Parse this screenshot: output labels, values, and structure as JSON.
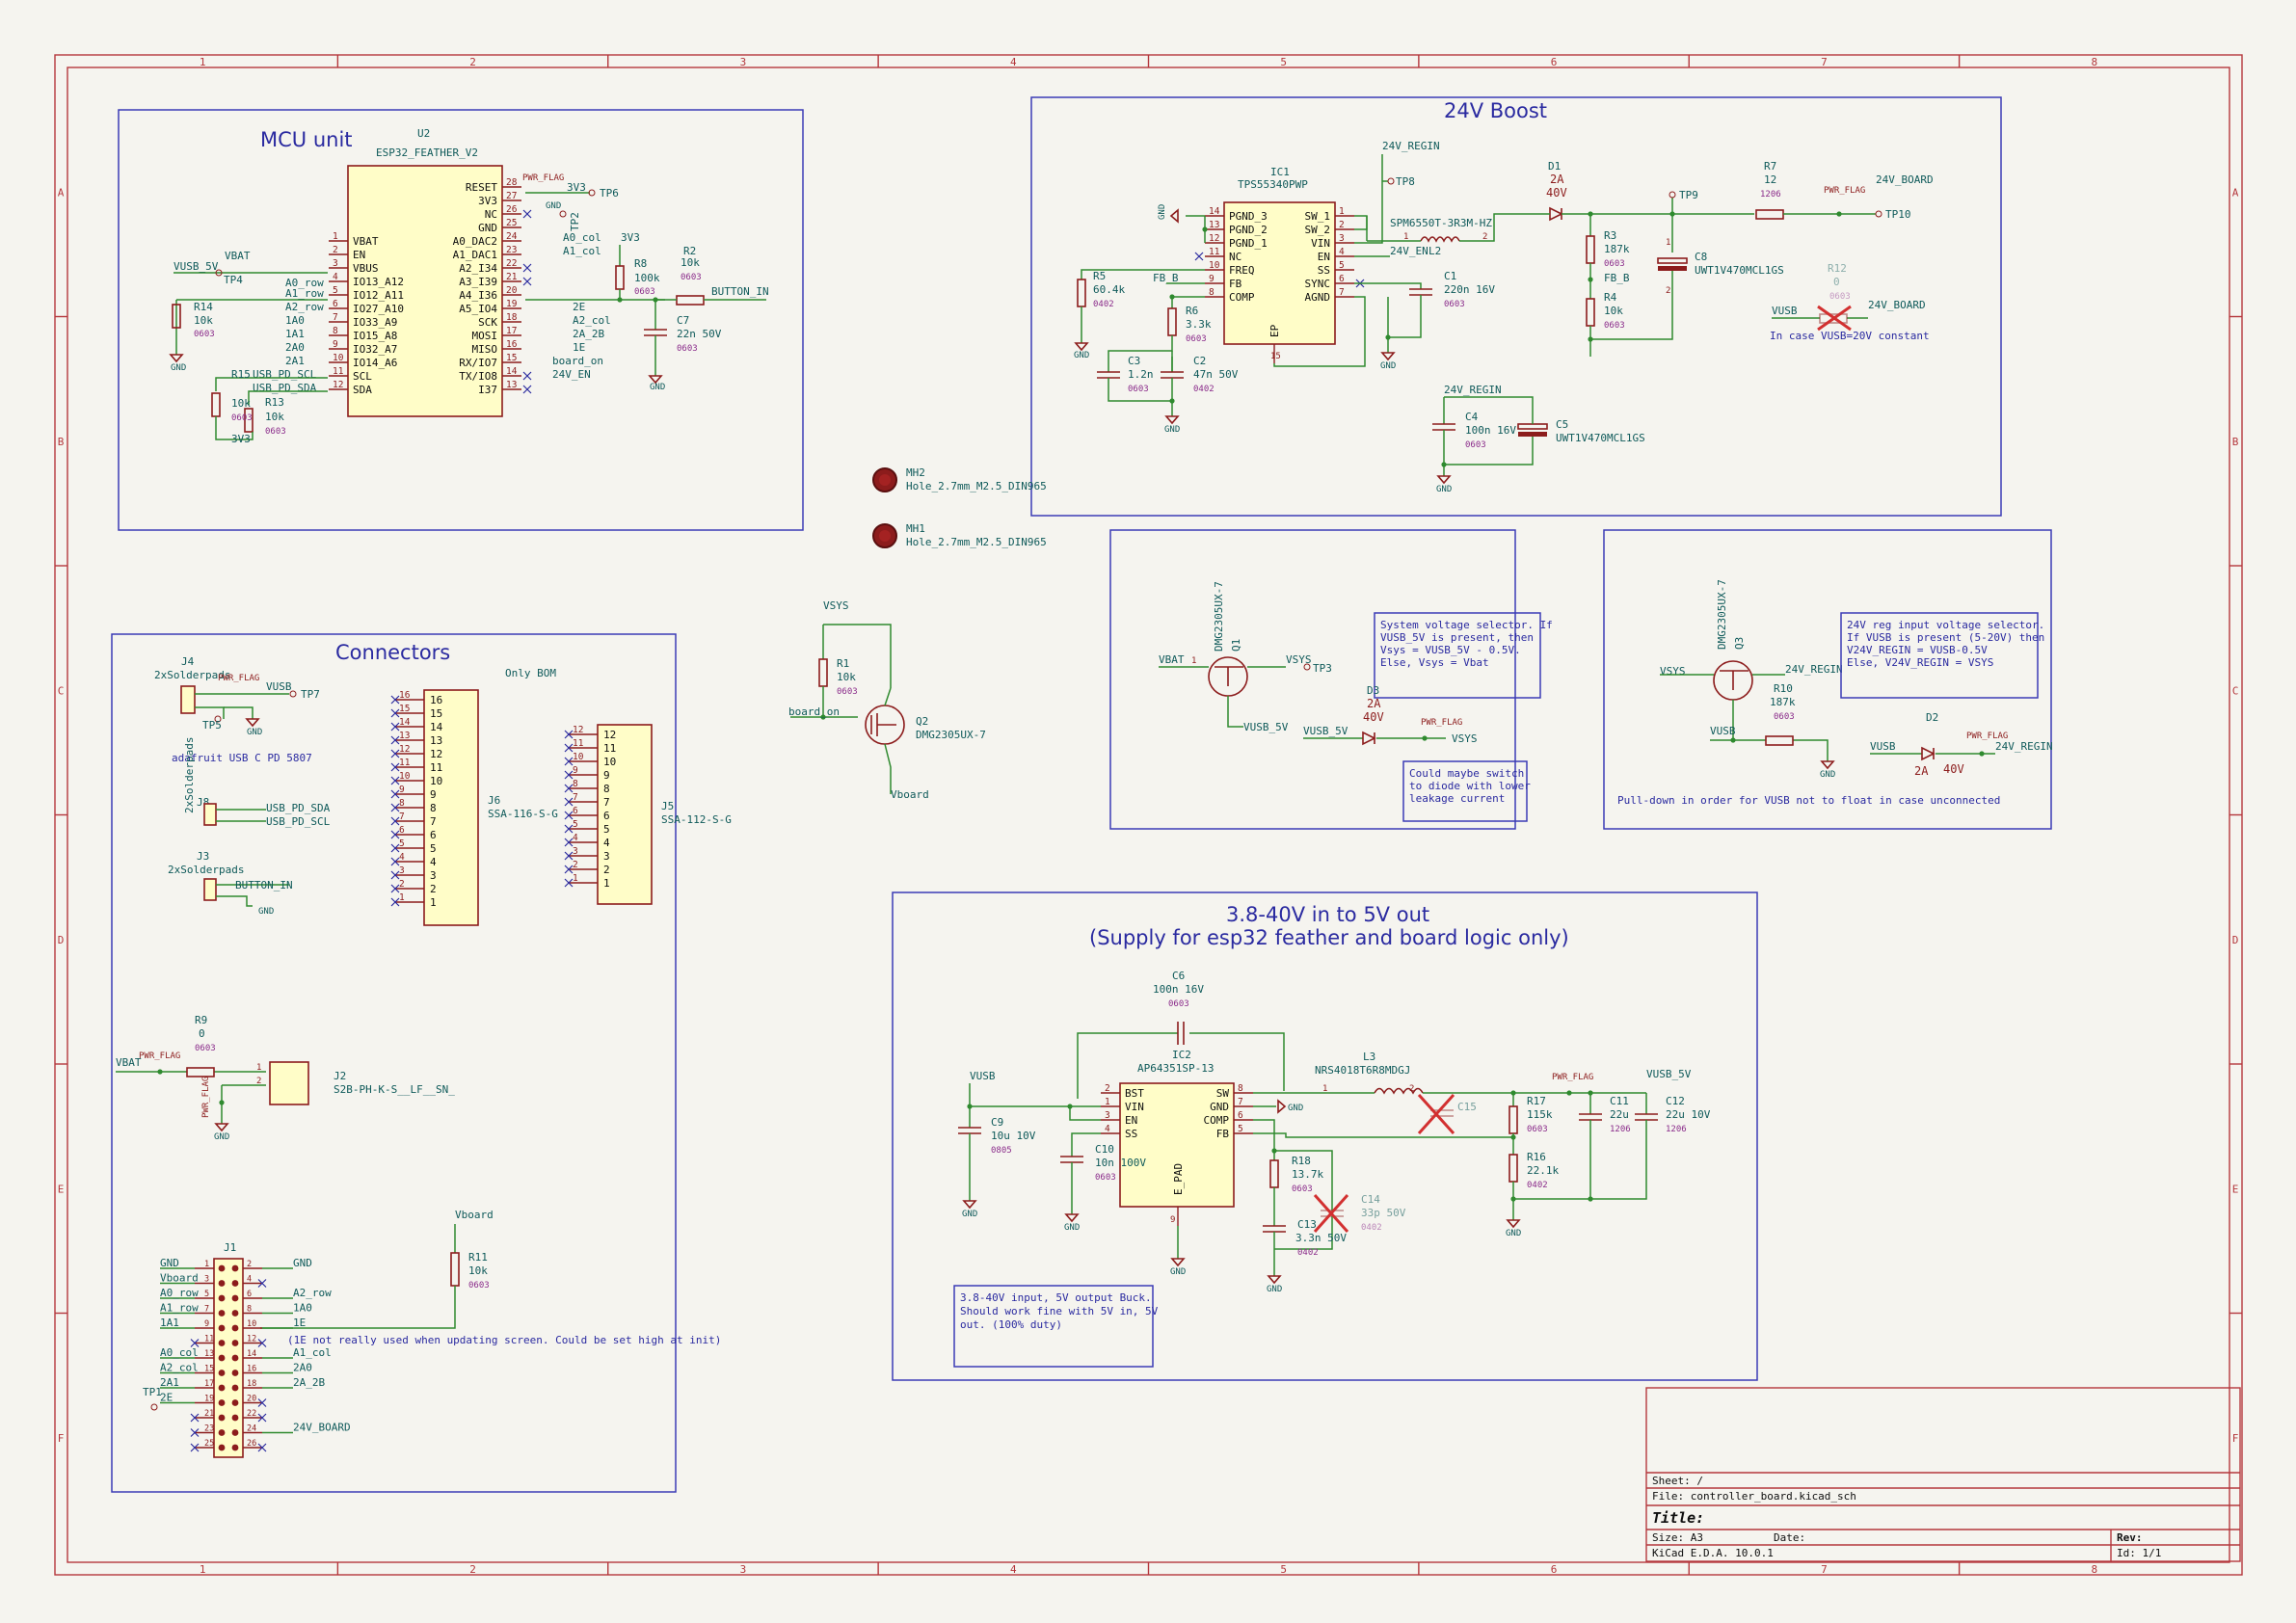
{
  "sheet": {
    "col_labels": [
      "1",
      "2",
      "3",
      "4",
      "5",
      "6",
      "7",
      "8"
    ],
    "row_labels": [
      "A",
      "B",
      "C",
      "D",
      "E",
      "F"
    ]
  },
  "colors": {
    "border": "#b4373c",
    "section": "#3b3bb5",
    "component": "#8c1c1c",
    "fill": "#fffdc8",
    "wire": "#2f8a2f",
    "text": "#0f5a5a",
    "footprint": "#8a2b8a",
    "note": "#2a2aa0"
  },
  "title_block": {
    "sheet": "Sheet: /",
    "file": "File: controller_board.kicad_sch",
    "title": "Title:",
    "size": "Size: A3",
    "date": "Date:",
    "rev": "Rev:",
    "tool": "KiCad E.D.A. 10.0.1",
    "id": "Id: 1/1"
  },
  "sections": {
    "mcu": "MCU unit",
    "boost": "24V Boost",
    "connectors": "Connectors",
    "buck_1": "3.8-40V in to 5V out",
    "buck_2": "(Supply for esp32 feather and board logic only)"
  },
  "mcu": {
    "ref": "U2",
    "value": "ESP32_FEATHER_V2",
    "left_pins": [
      {
        "num": "1",
        "name": "VBAT",
        "net": "VBAT"
      },
      {
        "num": "2",
        "name": "EN",
        "net": ""
      },
      {
        "num": "3",
        "name": "VBUS",
        "net": "VUSB_5V"
      },
      {
        "num": "4",
        "name": "IO13_A12",
        "net": "A0_row"
      },
      {
        "num": "5",
        "name": "IO12_A11",
        "net": "A1_row"
      },
      {
        "num": "6",
        "name": "IO27_A10",
        "net": "A2_row"
      },
      {
        "num": "7",
        "name": "IO33_A9",
        "net": "1A0"
      },
      {
        "num": "8",
        "name": "IO15_A8",
        "net": "1A1"
      },
      {
        "num": "9",
        "name": "IO32_A7",
        "net": "2A0"
      },
      {
        "num": "10",
        "name": "IO14_A6",
        "net": "2A1"
      },
      {
        "num": "11",
        "name": "SCL",
        "net": "USB_PD_SCL"
      },
      {
        "num": "12",
        "name": "SDA",
        "net": "USB_PD_SDA"
      }
    ],
    "right_pins": [
      {
        "num": "28",
        "name": "RESET",
        "net": ""
      },
      {
        "num": "27",
        "name": "3V3",
        "net": "3V3"
      },
      {
        "num": "26",
        "name": "NC",
        "net": ""
      },
      {
        "num": "25",
        "name": "GND",
        "net": ""
      },
      {
        "num": "24",
        "name": "A0_DAC2",
        "net": "A0_col"
      },
      {
        "num": "23",
        "name": "A1_DAC1",
        "net": "A1_col"
      },
      {
        "num": "22",
        "name": "A2_I34",
        "net": ""
      },
      {
        "num": "21",
        "name": "A3_I39",
        "net": ""
      },
      {
        "num": "20",
        "name": "A4_I36",
        "net": "2E"
      },
      {
        "num": "19",
        "name": "A5_IO4",
        "net": "A2_col"
      },
      {
        "num": "18",
        "name": "SCK",
        "net": "2A_2B"
      },
      {
        "num": "17",
        "name": "MOSI",
        "net": "1E"
      },
      {
        "num": "16",
        "name": "MISO",
        "net": "board_on"
      },
      {
        "num": "15",
        "name": "RX/IO7",
        "net": "24V_EN"
      },
      {
        "num": "14",
        "name": "TX/IO8",
        "net": ""
      },
      {
        "num": "13",
        "name": "I37",
        "net": ""
      }
    ],
    "pwr_flag": "PWR_FLAG",
    "gnd": "GND",
    "tp6": "TP6",
    "tp2": "TP2",
    "tp4": "TP4",
    "r14": {
      "ref": "R14",
      "value": "10k",
      "fp": "0603"
    },
    "r15": {
      "ref": "R15",
      "value": "10k",
      "fp": "0603"
    },
    "r13": {
      "ref": "R13",
      "value": "10k",
      "fp": "0603"
    },
    "r8": {
      "ref": "R8",
      "value": "100k",
      "fp": "0603"
    },
    "r2": {
      "ref": "R2",
      "value": "10k",
      "fp": "0603"
    },
    "c7": {
      "ref": "C7",
      "value": "22n 50V",
      "fp": "0603"
    },
    "net_3v3": "3V3",
    "button_in": "BUTTON_IN"
  },
  "boost": {
    "ic1_ref": "IC1",
    "ic1_value": "TPS55340PWP",
    "left_pins": [
      {
        "num": "14",
        "name": "PGND_3"
      },
      {
        "num": "13",
        "name": "PGND_2"
      },
      {
        "num": "12",
        "name": "PGND_1"
      },
      {
        "num": "11",
        "name": "NC"
      },
      {
        "num": "10",
        "name": "FREQ"
      },
      {
        "num": "9",
        "name": "FB"
      },
      {
        "num": "8",
        "name": "COMP"
      }
    ],
    "right_pins": [
      {
        "num": "1",
        "name": "SW_1"
      },
      {
        "num": "2",
        "name": "SW_2"
      },
      {
        "num": "3",
        "name": "VIN"
      },
      {
        "num": "4",
        "name": "EN"
      },
      {
        "num": "5",
        "name": "SS"
      },
      {
        "num": "6",
        "name": "SYNC"
      },
      {
        "num": "7",
        "name": "AGND"
      }
    ],
    "ep_pin": "15",
    "ep_name": "EP",
    "net_24v_regin": "24V_REGIN",
    "tp8": "TP8",
    "tp9": "TP9",
    "tp10": "TP10",
    "l2": {
      "ref": "L2",
      "value": "SPM6550T-3R3M-HZ"
    },
    "d1": {
      "ref": "D1",
      "value": "2A",
      "v": "40V"
    },
    "r7": {
      "ref": "R7",
      "value": "12",
      "fp": "1206"
    },
    "net_24v_board": "24V_BOARD",
    "net_24v_en": "24V_EN",
    "fb_b": "FB_B",
    "r5": {
      "ref": "R5",
      "value": "60.4k",
      "fp": "0402"
    },
    "r6": {
      "ref": "R6",
      "value": "3.3k",
      "fp": "0603"
    },
    "c3": {
      "ref": "C3",
      "value": "1.2n",
      "fp": "0603"
    },
    "c2": {
      "ref": "C2",
      "value": "47n 50V",
      "fp": "0402"
    },
    "c1": {
      "ref": "C1",
      "value": "220n 16V",
      "fp": "0603"
    },
    "r3": {
      "ref": "R3",
      "value": "187k",
      "fp": "0603"
    },
    "r4": {
      "ref": "R4",
      "value": "10k",
      "fp": "0603"
    },
    "c8": {
      "ref": "C8",
      "value": "UWT1V470MCL1GS"
    },
    "c4": {
      "ref": "C4",
      "value": "100n 16V",
      "fp": "0603"
    },
    "c5": {
      "ref": "C5",
      "value": "UWT1V470MCL1GS"
    },
    "r12": {
      "ref": "R12",
      "value": "0",
      "fp": "0603"
    },
    "vusb": "VUSB",
    "r12_note": "In case VUSB=20V constant",
    "pin_1": "1",
    "pin_2": "2"
  },
  "holes": [
    {
      "ref": "MH2",
      "value": "Hole_2.7mm_M2.5_DIN965"
    },
    {
      "ref": "MH1",
      "value": "Hole_2.7mm_M2.5_DIN965"
    }
  ],
  "vboard_switch": {
    "vsys": "VSYS",
    "r1": {
      "ref": "R1",
      "value": "10k",
      "fp": "0603"
    },
    "board_on": "board_on",
    "q2": {
      "ref": "Q2",
      "value": "DMG2305UX-7"
    },
    "vboard": "Vboard"
  },
  "sys_selector": {
    "q1": {
      "ref": "Q1",
      "value": "DMG2305UX-7"
    },
    "vbat": "VBAT",
    "vsys": "VSYS",
    "tp3": "TP3",
    "vusb_5v": "VUSB_5V",
    "d3": {
      "ref": "D3",
      "value": "2A",
      "v": "40V"
    },
    "pwr_flag": "PWR_FLAG",
    "note_lines": [
      "System voltage selector. If",
      "VUSB_5V is present, then",
      "Vsys = VUSB_5V - 0.5V.",
      "Else, Vsys = Vbat"
    ],
    "note2_lines": [
      "Could maybe switch",
      "to diode with lower",
      "leakage current"
    ]
  },
  "reg_selector": {
    "q3": {
      "ref": "Q3",
      "value": "DMG2305UX-7"
    },
    "vsys": "VSYS",
    "net_24v_regin": "24V_REGIN",
    "r10": {
      "ref": "R10",
      "value": "187k",
      "fp": "0603"
    },
    "vusb": "VUSB",
    "d2": {
      "ref": "D2",
      "value": "2A",
      "v": "40V"
    },
    "pwr_flag": "PWR_FLAG",
    "note_lines": [
      "24V reg input voltage selector.",
      "If VUSB is present (5-20V) then",
      "V24V_REGIN = VUSB-0.5V",
      "Else, V24V_REGIN = VSYS"
    ],
    "note2": "Pull-down in order for VUSB not to float in case unconnected"
  },
  "connectors": {
    "j4": {
      "ref": "J4",
      "value": "2xSolderpads"
    },
    "vusb": "VUSB",
    "tp7": "TP7",
    "tp5": "TP5",
    "pwr_flag": "PWR_FLAG",
    "adafruit": "adafruit USB C PD 5807",
    "j8": {
      "ref": "J8",
      "value": "2xSolderpads"
    },
    "usb_pd_sda": "USB_PD_SDA",
    "usb_pd_scl": "USB_PD_SCL",
    "j3": {
      "ref": "J3",
      "value": "2xSolderpads"
    },
    "button_in": "BUTTON_IN",
    "only_bom": "Only BOM",
    "j6": {
      "ref": "J6",
      "value": "SSA-116-S-G"
    },
    "j5": {
      "ref": "J5",
      "value": "SSA-112-S-G"
    },
    "r9": {
      "ref": "R9",
      "value": "0",
      "fp": "0603"
    },
    "vbat": "VBAT",
    "j2": {
      "ref": "J2",
      "value": "S2B-PH-K-S__LF__SN_"
    },
    "vboard": "Vboard",
    "r11": {
      "ref": "R11",
      "value": "10k",
      "fp": "0603"
    },
    "j1": "J1",
    "j1_left": [
      "GND",
      "Vboard",
      "A0_row",
      "A1_row",
      "1A1",
      "",
      "A0_col",
      "A2_col",
      "2A1",
      "2E",
      "",
      "",
      ""
    ],
    "j1_right": [
      "GND",
      "",
      "A2_row",
      "1A0",
      "1E",
      "",
      "A1_col",
      "2A0",
      "2A_2B",
      "",
      "",
      "24V_BOARD",
      ""
    ],
    "tp1": "TP1",
    "e_note": "(1E not really used when updating screen. Could be set high at init)"
  },
  "buck": {
    "c6": {
      "ref": "C6",
      "value": "100n 16V",
      "fp": "0603"
    },
    "ic2": {
      "ref": "IC2",
      "value": "AP64351SP-13"
    },
    "left_pins": [
      {
        "num": "2",
        "name": "BST"
      },
      {
        "num": "1",
        "name": "VIN"
      },
      {
        "num": "3",
        "name": "EN"
      },
      {
        "num": "4",
        "name": "SS"
      }
    ],
    "right_pins": [
      {
        "num": "8",
        "name": "SW"
      },
      {
        "num": "7",
        "name": "GND"
      },
      {
        "num": "6",
        "name": "COMP"
      },
      {
        "num": "5",
        "name": "FB"
      }
    ],
    "epad_pin": "9",
    "epad": "E_PAD",
    "vusb": "VUSB",
    "c9": {
      "ref": "C9",
      "value": "10u 10V",
      "fp": "0805"
    },
    "c10": {
      "ref": "C10",
      "value": "10n 100V",
      "fp": "0603"
    },
    "l3": {
      "ref": "L3",
      "value": "NRS4018T6R8MDGJ"
    },
    "c15": {
      "ref": "C15",
      "value": ""
    },
    "vusb_5v": "VUSB_5V",
    "pwr_flag": "PWR_FLAG",
    "r17": {
      "ref": "R17",
      "value": "115k",
      "fp": "0603"
    },
    "r16": {
      "ref": "R16",
      "value": "22.1k",
      "fp": "0402"
    },
    "c11": {
      "ref": "C11",
      "value": "22u",
      "fp": "1206"
    },
    "c12": {
      "ref": "C12",
      "value": "22u 10V",
      "fp": "1206"
    },
    "r18": {
      "ref": "R18",
      "value": "13.7k",
      "fp": "0603"
    },
    "c14": {
      "ref": "C14",
      "value": "33p 50V",
      "fp": "0402"
    },
    "c13": {
      "ref": "C13",
      "value": "3.3n 50V",
      "fp": "0402"
    },
    "pin_1": "1",
    "pin_2": "2",
    "note_lines": [
      "3.8-40V input, 5V output Buck.",
      "Should work fine with 5V in, 5V",
      "out. (100% duty)"
    ]
  }
}
